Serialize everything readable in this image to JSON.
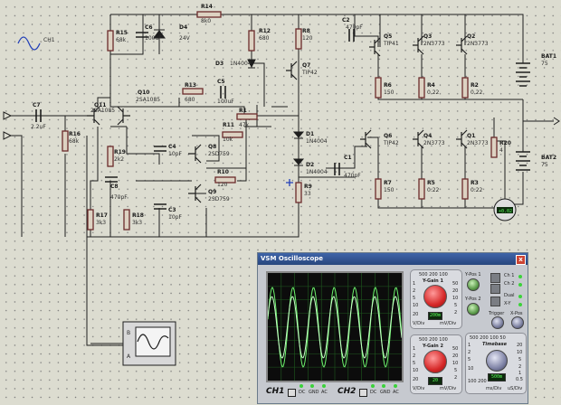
{
  "schematic": {
    "resistors": [
      {
        "ref": "R14",
        "value": "8k0"
      },
      {
        "ref": "R15",
        "value": "68k"
      },
      {
        "ref": "R12",
        "value": "680"
      },
      {
        "ref": "R8",
        "value": "120"
      },
      {
        "ref": "R6",
        "value": "150"
      },
      {
        "ref": "R4",
        "value": "0.22"
      },
      {
        "ref": "R2",
        "value": "0.22"
      },
      {
        "ref": "R13",
        "value": "680"
      },
      {
        "ref": "R1",
        "value": "47k"
      },
      {
        "ref": "R16",
        "value": "68k"
      },
      {
        "ref": "R11",
        "value": "10k"
      },
      {
        "ref": "R19",
        "value": "2k2"
      },
      {
        "ref": "R10",
        "value": "120"
      },
      {
        "ref": "R17",
        "value": "3k3"
      },
      {
        "ref": "R18",
        "value": "3k3"
      },
      {
        "ref": "R7",
        "value": "150"
      },
      {
        "ref": "R5",
        "value": "0.22"
      },
      {
        "ref": "R3",
        "value": "0.22"
      },
      {
        "ref": "R20",
        "value": "4"
      },
      {
        "ref": "R9",
        "value": "33"
      }
    ],
    "capacitors": [
      {
        "ref": "C6",
        "value": "100uF"
      },
      {
        "ref": "C2",
        "value": "470pF"
      },
      {
        "ref": "C5",
        "value": "100uF"
      },
      {
        "ref": "C7",
        "value": "2.2uF"
      },
      {
        "ref": "C4",
        "value": "10pF"
      },
      {
        "ref": "C8",
        "value": "470pF"
      },
      {
        "ref": "C3",
        "value": "10pF"
      },
      {
        "ref": "C1",
        "value": "470pF"
      }
    ],
    "transistors": [
      {
        "ref": "Q5",
        "value": "TIP41"
      },
      {
        "ref": "Q3",
        "value": "2N3773"
      },
      {
        "ref": "Q2",
        "value": "2N3773"
      },
      {
        "ref": "Q7",
        "value": "TIP42"
      },
      {
        "ref": "Q11",
        "value": "2SA1085"
      },
      {
        "ref": "Q10",
        "value": "2SA1085"
      },
      {
        "ref": "Q8",
        "value": "2SD759"
      },
      {
        "ref": "Q9",
        "value": "2SD759"
      },
      {
        "ref": "Q6",
        "value": "TIP42"
      },
      {
        "ref": "Q4",
        "value": "2N3773"
      },
      {
        "ref": "Q1",
        "value": "2N3773"
      }
    ],
    "diodes": [
      {
        "ref": "D4",
        "value": "24V"
      },
      {
        "ref": "D3",
        "value": "1N4004"
      },
      {
        "ref": "D1",
        "value": "1N4004"
      },
      {
        "ref": "D2",
        "value": "1N4004"
      }
    ],
    "batteries": [
      {
        "ref": "BAT1",
        "value": "75"
      },
      {
        "ref": "BAT2",
        "value": "75"
      }
    ],
    "source_label": "CH1",
    "meter_reading": "+0.02",
    "scope_symbol_pins": [
      "A",
      "B"
    ]
  },
  "oscilloscope": {
    "title": "VSM Oscilloscope",
    "close_glyph": "x",
    "ydiv1": {
      "label": "Y-Gain 1",
      "ticks_top": "500 200 100",
      "tick_l1": "1",
      "tick_l2": "2",
      "tick_l3": "5",
      "tick_l4": "10",
      "tick_l5": "20",
      "tick_r1": "50",
      "tick_r2": "20",
      "tick_r3": "10",
      "tick_r4": "5",
      "tick_r5": "2",
      "unit_l": "V/Div",
      "unit_r": "mV/Div",
      "lcd": "200m"
    },
    "ydiv2": {
      "label": "Y-Gain 2",
      "ticks_top": "500 200 100",
      "tick_l1": "1",
      "tick_l2": "2",
      "tick_l3": "5",
      "tick_l4": "10",
      "tick_l5": "20",
      "tick_r1": "50",
      "tick_r2": "20",
      "tick_r3": "10",
      "tick_r4": "5",
      "tick_r5": "2",
      "unit_l": "V/Div",
      "unit_r": "mV/Div",
      "lcd": "20"
    },
    "timebase": {
      "label": "Timebase",
      "ticks_top": "500 200 100 50",
      "tick_l1": "1",
      "tick_l2": "2",
      "tick_l3": "5",
      "tick_l4": "10",
      "tick_r1": "20",
      "tick_r2": "10",
      "tick_r3": "5",
      "tick_r4": "2",
      "tick_r5": "1",
      "tick_r6": "0.5",
      "bottom_l": "100 200",
      "unit_l": "ms/Div",
      "unit_r": "uS/Div",
      "lcd": "500m"
    },
    "ypos1": "Y-Pos 1",
    "ypos2": "Y-Pos 2",
    "trigger": "Trigger",
    "xpos": "X-Pos",
    "ch1_btn": "Ch 1",
    "ch2_btn": "Ch 2",
    "dual": "Dual",
    "xy": "X-Y",
    "ch1": "CH1",
    "ch2": "CH2",
    "coupling": [
      "DC",
      "GND",
      "AC"
    ]
  }
}
